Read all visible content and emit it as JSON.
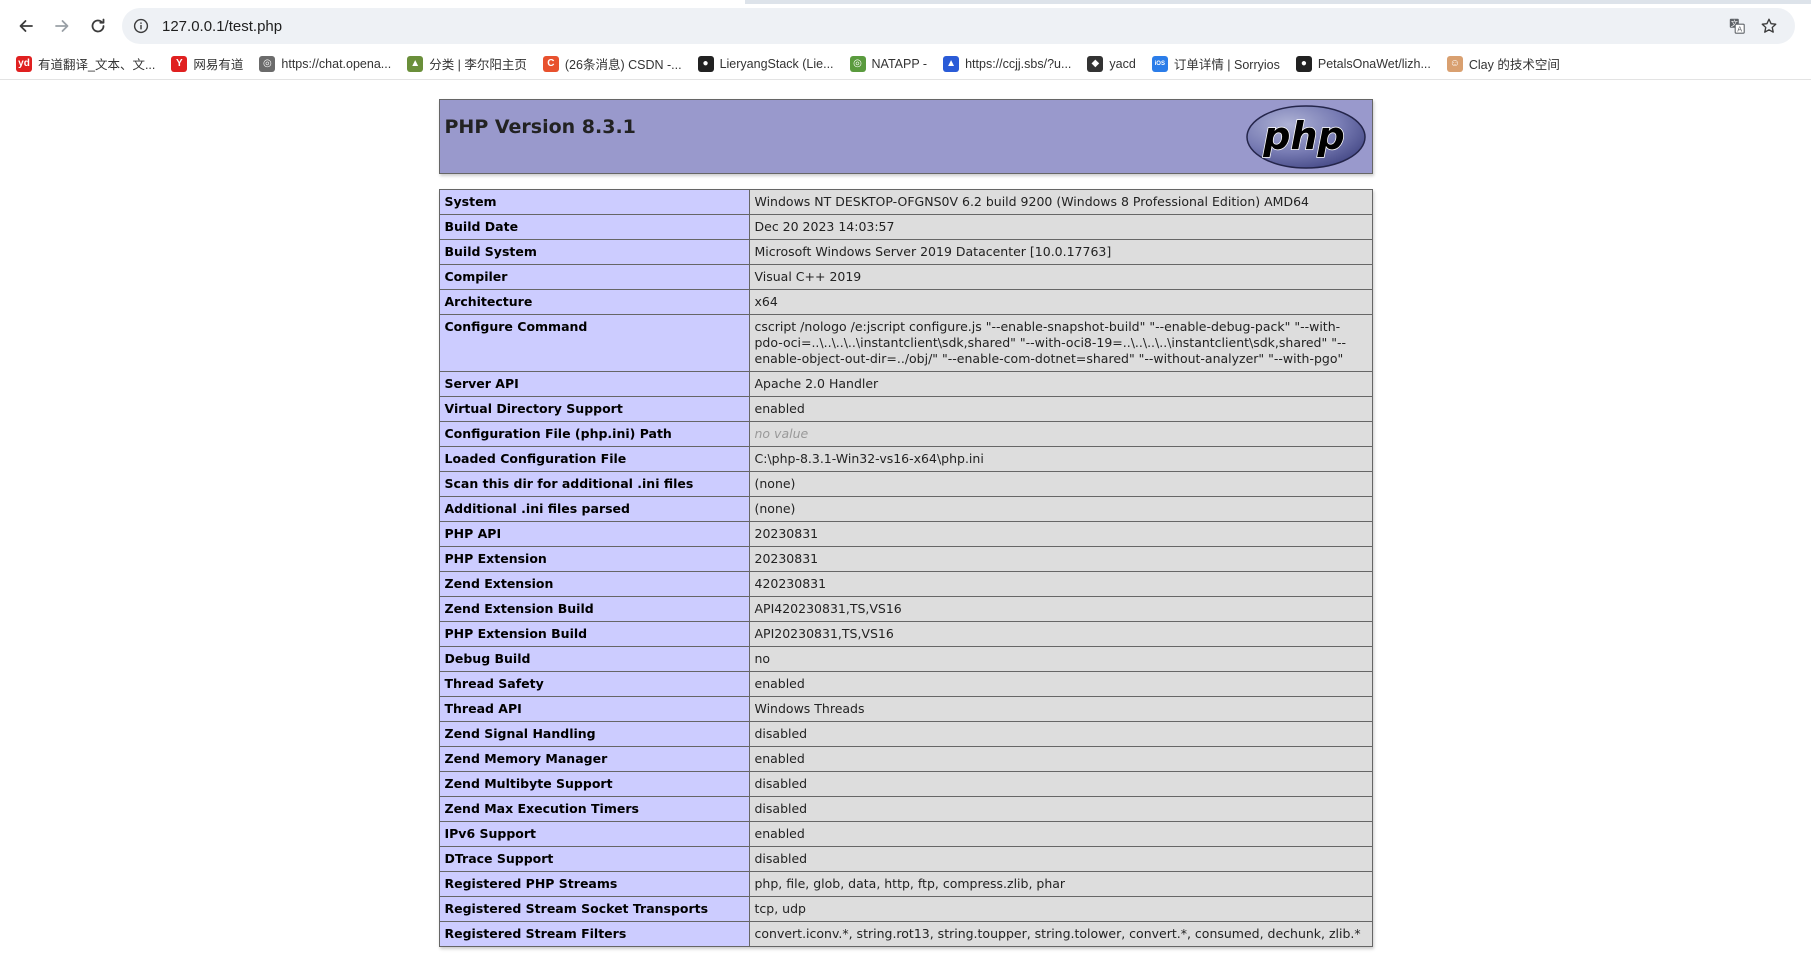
{
  "browser": {
    "url": "127.0.0.1/test.php",
    "bookmarks": [
      {
        "label": "有道翻译_文本、文...",
        "icon": "youdao-icon",
        "color": "#e02020",
        "glyph": "yd"
      },
      {
        "label": "网易有道",
        "icon": "netease-youdao-icon",
        "color": "#e02020",
        "glyph": "Y"
      },
      {
        "label": "https://chat.opena...",
        "icon": "openai-icon",
        "color": "#6b6b6b",
        "glyph": "◎"
      },
      {
        "label": "分类 | 李尔阳主页",
        "icon": "landscape-icon",
        "color": "#6a8f3a",
        "glyph": "▲"
      },
      {
        "label": "(26条消息) CSDN -...",
        "icon": "csdn-icon",
        "color": "#e8512e",
        "glyph": "C"
      },
      {
        "label": "LieryangStack (Lie...",
        "icon": "github-icon",
        "color": "#222222",
        "glyph": "●"
      },
      {
        "label": "NATAPP -",
        "icon": "natapp-icon",
        "color": "#5a9b3e",
        "glyph": "◎"
      },
      {
        "label": "https://ccjj.sbs/?u...",
        "icon": "triangle-icon",
        "color": "#2a5bd7",
        "glyph": "▲"
      },
      {
        "label": "yacd",
        "icon": "cat-icon",
        "color": "#333333",
        "glyph": "◆"
      },
      {
        "label": "订单详情 | Sorryios",
        "icon": "ios-icon",
        "color": "#2b7de9",
        "glyph": "iOS"
      },
      {
        "label": "PetalsOnaWet/lizh...",
        "icon": "github-icon",
        "color": "#222222",
        "glyph": "●"
      },
      {
        "label": "Clay 的技术空间",
        "icon": "avatar-icon",
        "color": "#d9a070",
        "glyph": "☺"
      }
    ]
  },
  "php": {
    "title": "PHP Version 8.3.1",
    "logo_text": "php",
    "rows": [
      {
        "key": "System",
        "value": "Windows NT DESKTOP-OFGNS0V 6.2 build 9200 (Windows 8 Professional Edition) AMD64"
      },
      {
        "key": "Build Date",
        "value": "Dec 20 2023 14:03:57"
      },
      {
        "key": "Build System",
        "value": "Microsoft Windows Server 2019 Datacenter [10.0.17763]"
      },
      {
        "key": "Compiler",
        "value": "Visual C++ 2019"
      },
      {
        "key": "Architecture",
        "value": "x64"
      },
      {
        "key": "Configure Command",
        "value": "cscript /nologo /e:jscript configure.js \"--enable-snapshot-build\" \"--enable-debug-pack\" \"--with-pdo-oci=..\\..\\..\\..\\instantclient\\sdk,shared\" \"--with-oci8-19=..\\..\\..\\..\\instantclient\\sdk,shared\" \"--enable-object-out-dir=../obj/\" \"--enable-com-dotnet=shared\" \"--without-analyzer\" \"--with-pgo\""
      },
      {
        "key": "Server API",
        "value": "Apache 2.0 Handler"
      },
      {
        "key": "Virtual Directory Support",
        "value": "enabled"
      },
      {
        "key": "Configuration File (php.ini) Path",
        "value": "no value",
        "novalue": true
      },
      {
        "key": "Loaded Configuration File",
        "value": "C:\\php-8.3.1-Win32-vs16-x64\\php.ini"
      },
      {
        "key": "Scan this dir for additional .ini files",
        "value": "(none)"
      },
      {
        "key": "Additional .ini files parsed",
        "value": "(none)"
      },
      {
        "key": "PHP API",
        "value": "20230831"
      },
      {
        "key": "PHP Extension",
        "value": "20230831"
      },
      {
        "key": "Zend Extension",
        "value": "420230831"
      },
      {
        "key": "Zend Extension Build",
        "value": "API420230831,TS,VS16"
      },
      {
        "key": "PHP Extension Build",
        "value": "API20230831,TS,VS16"
      },
      {
        "key": "Debug Build",
        "value": "no"
      },
      {
        "key": "Thread Safety",
        "value": "enabled"
      },
      {
        "key": "Thread API",
        "value": "Windows Threads"
      },
      {
        "key": "Zend Signal Handling",
        "value": "disabled"
      },
      {
        "key": "Zend Memory Manager",
        "value": "enabled"
      },
      {
        "key": "Zend Multibyte Support",
        "value": "disabled"
      },
      {
        "key": "Zend Max Execution Timers",
        "value": "disabled"
      },
      {
        "key": "IPv6 Support",
        "value": "enabled"
      },
      {
        "key": "DTrace Support",
        "value": "disabled"
      },
      {
        "key": "Registered PHP Streams",
        "value": "php, file, glob, data, http, ftp, compress.zlib, phar"
      },
      {
        "key": "Registered Stream Socket Transports",
        "value": "tcp, udp"
      },
      {
        "key": "Registered Stream Filters",
        "value": "convert.iconv.*, string.rot13, string.toupper, string.tolower, convert.*, consumed, dechunk, zlib.*"
      }
    ]
  }
}
